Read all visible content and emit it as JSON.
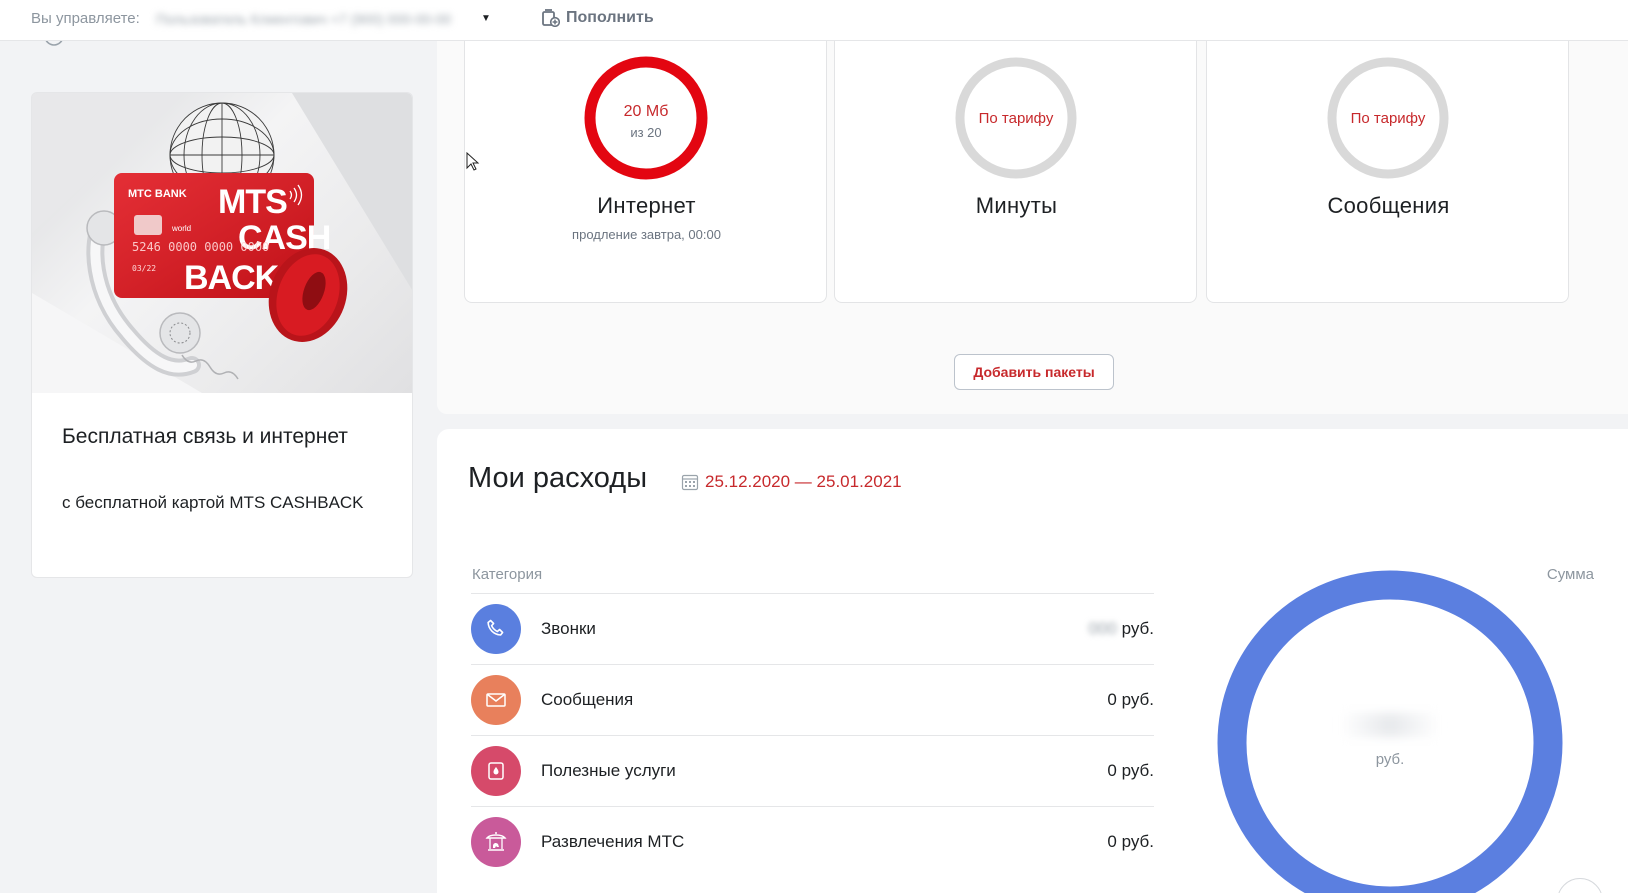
{
  "topbar": {
    "manage_label": "Вы управляете:",
    "manage_name": "Пользователь Клиентович +7 (900) 000-00-00",
    "topup_label": "Пополнить"
  },
  "promo": {
    "title": "Бесплатная связь и интернет",
    "text": "с бесплатной картой MTS CASHBACK",
    "image": {
      "bank_logo": "МТС BANK",
      "card_big_text": [
        "MTS",
        "CASH",
        "BACK"
      ],
      "card_world": "world",
      "card_number": "5246 0000 0000 0000",
      "card_expiry": "03/22"
    }
  },
  "remainders": [
    {
      "value": "20 Мб",
      "sub": "из 20",
      "title": "Интернет",
      "note": "продление завтра, 00:00",
      "fill_fraction": 1.0,
      "color": "#e30611"
    },
    {
      "value": "По тарифу",
      "title": "Минуты",
      "color": "#d9d9d9"
    },
    {
      "value": "По тарифу",
      "title": "Сообщения",
      "color": "#d9d9d9"
    }
  ],
  "add_packages_label": "Добавить пакеты",
  "expenses": {
    "title": "Мои расходы",
    "period": "25.12.2020 — 25.01.2021",
    "col_category": "Категория",
    "col_sum": "Сумма",
    "rows": [
      {
        "label": "Звонки",
        "amount": "000",
        "unit": "руб.",
        "icon": "phone-icon",
        "color": "#5a7fdf"
      },
      {
        "label": "Сообщения",
        "amount": "0",
        "unit": "руб.",
        "icon": "envelope-icon",
        "color": "#e8805c"
      },
      {
        "label": "Полезные услуги",
        "amount": "0",
        "unit": "руб.",
        "icon": "services-icon",
        "color": "#d64a6a"
      },
      {
        "label": "Развлечения МТС",
        "amount": "0",
        "unit": "руб.",
        "icon": "carousel-icon",
        "color": "#c95a9a"
      }
    ],
    "donut": {
      "amount": "000",
      "unit": "руб.",
      "color": "#5b7fe0"
    }
  },
  "colors": {
    "accent": "#c7292c",
    "mts_red": "#e30611"
  }
}
